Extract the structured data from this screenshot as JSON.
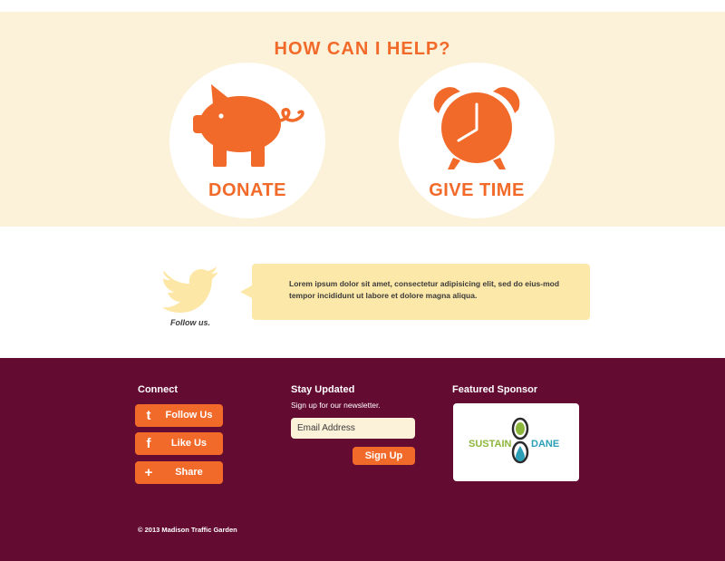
{
  "colors": {
    "accent": "#f26a2a",
    "cream": "#fcf2d9",
    "bubble": "#fce9a9",
    "footer_bg": "#640b32",
    "bird": "#fde7a6"
  },
  "help": {
    "title": "HOW CAN I HELP?",
    "options": [
      {
        "label": "DONATE",
        "icon": "piggy-bank-icon"
      },
      {
        "label": "GIVE TIME",
        "icon": "alarm-clock-icon"
      }
    ]
  },
  "twitter": {
    "icon": "twitter-bird-icon",
    "caption": "Follow us.",
    "tweet": "Lorem ipsum dolor sit amet, consectetur adipisicing elit, sed do eius-mod tempor incididunt ut labore et dolore magna aliqua."
  },
  "footer": {
    "connect": {
      "title": "Connect",
      "buttons": [
        {
          "label": "Follow Us",
          "icon": "twitter-icon",
          "glyph": "t"
        },
        {
          "label": "Like Us",
          "icon": "facebook-icon",
          "glyph": "f"
        },
        {
          "label": "Share",
          "icon": "plus-icon",
          "glyph": "+"
        }
      ]
    },
    "newsletter": {
      "title": "Stay Updated",
      "description": "Sign up for our newsletter.",
      "email_placeholder": "Email Address",
      "submit_label": "Sign Up"
    },
    "sponsor": {
      "title": "Featured Sponsor",
      "logo_left": "SUSTAIN",
      "logo_right": "DANE"
    },
    "copyright": "© 2013 Madison Traffic Garden"
  }
}
